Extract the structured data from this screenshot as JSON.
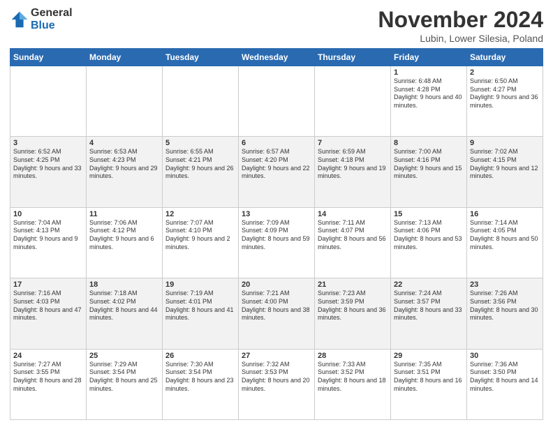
{
  "logo": {
    "general": "General",
    "blue": "Blue"
  },
  "header": {
    "month": "November 2024",
    "location": "Lubin, Lower Silesia, Poland"
  },
  "days": [
    "Sunday",
    "Monday",
    "Tuesday",
    "Wednesday",
    "Thursday",
    "Friday",
    "Saturday"
  ],
  "weeks": [
    [
      {
        "day": "",
        "info": ""
      },
      {
        "day": "",
        "info": ""
      },
      {
        "day": "",
        "info": ""
      },
      {
        "day": "",
        "info": ""
      },
      {
        "day": "",
        "info": ""
      },
      {
        "day": "1",
        "info": "Sunrise: 6:48 AM\nSunset: 4:28 PM\nDaylight: 9 hours and 40 minutes."
      },
      {
        "day": "2",
        "info": "Sunrise: 6:50 AM\nSunset: 4:27 PM\nDaylight: 9 hours and 36 minutes."
      }
    ],
    [
      {
        "day": "3",
        "info": "Sunrise: 6:52 AM\nSunset: 4:25 PM\nDaylight: 9 hours and 33 minutes."
      },
      {
        "day": "4",
        "info": "Sunrise: 6:53 AM\nSunset: 4:23 PM\nDaylight: 9 hours and 29 minutes."
      },
      {
        "day": "5",
        "info": "Sunrise: 6:55 AM\nSunset: 4:21 PM\nDaylight: 9 hours and 26 minutes."
      },
      {
        "day": "6",
        "info": "Sunrise: 6:57 AM\nSunset: 4:20 PM\nDaylight: 9 hours and 22 minutes."
      },
      {
        "day": "7",
        "info": "Sunrise: 6:59 AM\nSunset: 4:18 PM\nDaylight: 9 hours and 19 minutes."
      },
      {
        "day": "8",
        "info": "Sunrise: 7:00 AM\nSunset: 4:16 PM\nDaylight: 9 hours and 15 minutes."
      },
      {
        "day": "9",
        "info": "Sunrise: 7:02 AM\nSunset: 4:15 PM\nDaylight: 9 hours and 12 minutes."
      }
    ],
    [
      {
        "day": "10",
        "info": "Sunrise: 7:04 AM\nSunset: 4:13 PM\nDaylight: 9 hours and 9 minutes."
      },
      {
        "day": "11",
        "info": "Sunrise: 7:06 AM\nSunset: 4:12 PM\nDaylight: 9 hours and 6 minutes."
      },
      {
        "day": "12",
        "info": "Sunrise: 7:07 AM\nSunset: 4:10 PM\nDaylight: 9 hours and 2 minutes."
      },
      {
        "day": "13",
        "info": "Sunrise: 7:09 AM\nSunset: 4:09 PM\nDaylight: 8 hours and 59 minutes."
      },
      {
        "day": "14",
        "info": "Sunrise: 7:11 AM\nSunset: 4:07 PM\nDaylight: 8 hours and 56 minutes."
      },
      {
        "day": "15",
        "info": "Sunrise: 7:13 AM\nSunset: 4:06 PM\nDaylight: 8 hours and 53 minutes."
      },
      {
        "day": "16",
        "info": "Sunrise: 7:14 AM\nSunset: 4:05 PM\nDaylight: 8 hours and 50 minutes."
      }
    ],
    [
      {
        "day": "17",
        "info": "Sunrise: 7:16 AM\nSunset: 4:03 PM\nDaylight: 8 hours and 47 minutes."
      },
      {
        "day": "18",
        "info": "Sunrise: 7:18 AM\nSunset: 4:02 PM\nDaylight: 8 hours and 44 minutes."
      },
      {
        "day": "19",
        "info": "Sunrise: 7:19 AM\nSunset: 4:01 PM\nDaylight: 8 hours and 41 minutes."
      },
      {
        "day": "20",
        "info": "Sunrise: 7:21 AM\nSunset: 4:00 PM\nDaylight: 8 hours and 38 minutes."
      },
      {
        "day": "21",
        "info": "Sunrise: 7:23 AM\nSunset: 3:59 PM\nDaylight: 8 hours and 36 minutes."
      },
      {
        "day": "22",
        "info": "Sunrise: 7:24 AM\nSunset: 3:57 PM\nDaylight: 8 hours and 33 minutes."
      },
      {
        "day": "23",
        "info": "Sunrise: 7:26 AM\nSunset: 3:56 PM\nDaylight: 8 hours and 30 minutes."
      }
    ],
    [
      {
        "day": "24",
        "info": "Sunrise: 7:27 AM\nSunset: 3:55 PM\nDaylight: 8 hours and 28 minutes."
      },
      {
        "day": "25",
        "info": "Sunrise: 7:29 AM\nSunset: 3:54 PM\nDaylight: 8 hours and 25 minutes."
      },
      {
        "day": "26",
        "info": "Sunrise: 7:30 AM\nSunset: 3:54 PM\nDaylight: 8 hours and 23 minutes."
      },
      {
        "day": "27",
        "info": "Sunrise: 7:32 AM\nSunset: 3:53 PM\nDaylight: 8 hours and 20 minutes."
      },
      {
        "day": "28",
        "info": "Sunrise: 7:33 AM\nSunset: 3:52 PM\nDaylight: 8 hours and 18 minutes."
      },
      {
        "day": "29",
        "info": "Sunrise: 7:35 AM\nSunset: 3:51 PM\nDaylight: 8 hours and 16 minutes."
      },
      {
        "day": "30",
        "info": "Sunrise: 7:36 AM\nSunset: 3:50 PM\nDaylight: 8 hours and 14 minutes."
      }
    ]
  ]
}
